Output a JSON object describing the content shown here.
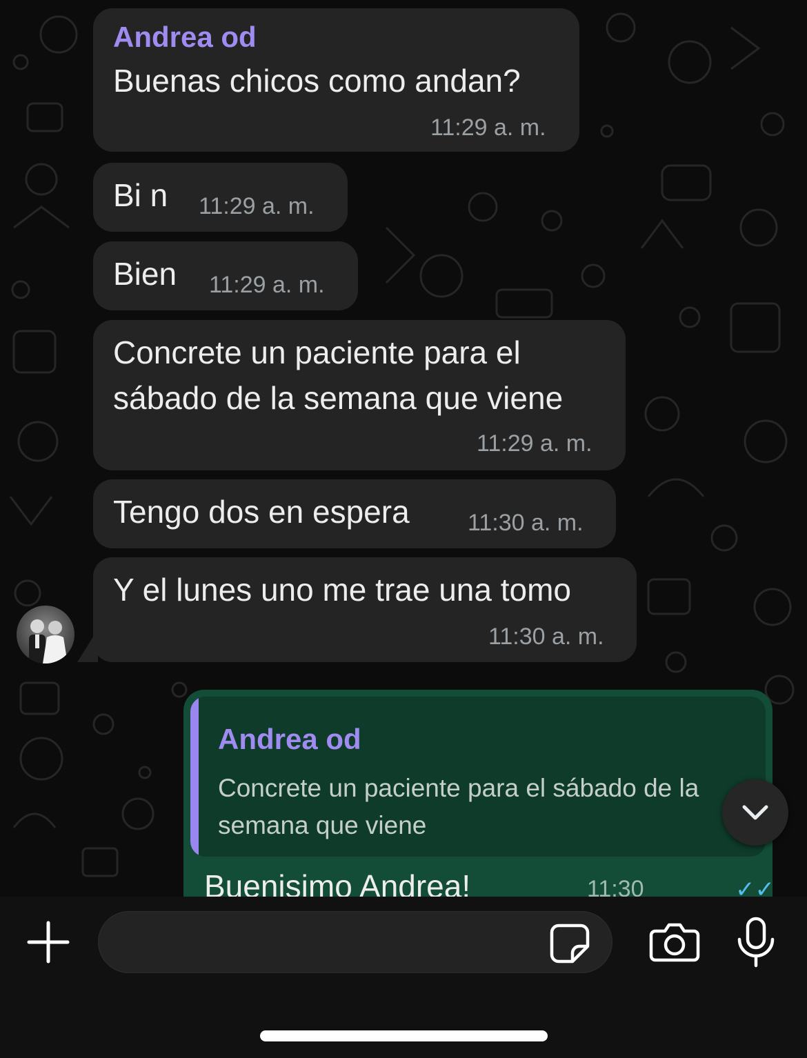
{
  "messages": [
    {
      "sender": "Andrea od",
      "text": "Buenas chicos como andan?",
      "time": "11:29 a. m."
    },
    {
      "text": "Bi n",
      "time": "11:29 a. m."
    },
    {
      "text": "Bien",
      "time": "11:29 a. m."
    },
    {
      "lines": [
        "Concrete un paciente para el",
        "sábado de la semana que viene"
      ],
      "time": "11:29 a. m."
    },
    {
      "text": "Tengo dos en espera",
      "time": "11:30 a. m."
    },
    {
      "text": "Y el lunes uno me trae una tomo",
      "time": "11:30 a. m."
    }
  ],
  "reply": {
    "quoted_sender": "Andrea od",
    "quoted_text": "Concrete un paciente para el sábado de la semana que viene",
    "text": "Buenisimo Andrea!",
    "time": "11:30",
    "status_icon": "double-check-icon",
    "status_symbol": "✓✓"
  },
  "composer": {
    "placeholder": "",
    "icons": [
      "plus-icon",
      "sticker-icon",
      "camera-icon",
      "microphone-icon"
    ]
  },
  "colors": {
    "incoming_bubble": "#242424",
    "outgoing_bubble": "#144d37",
    "sender_name": "#a08cf0",
    "read_check": "#53bdeb"
  }
}
